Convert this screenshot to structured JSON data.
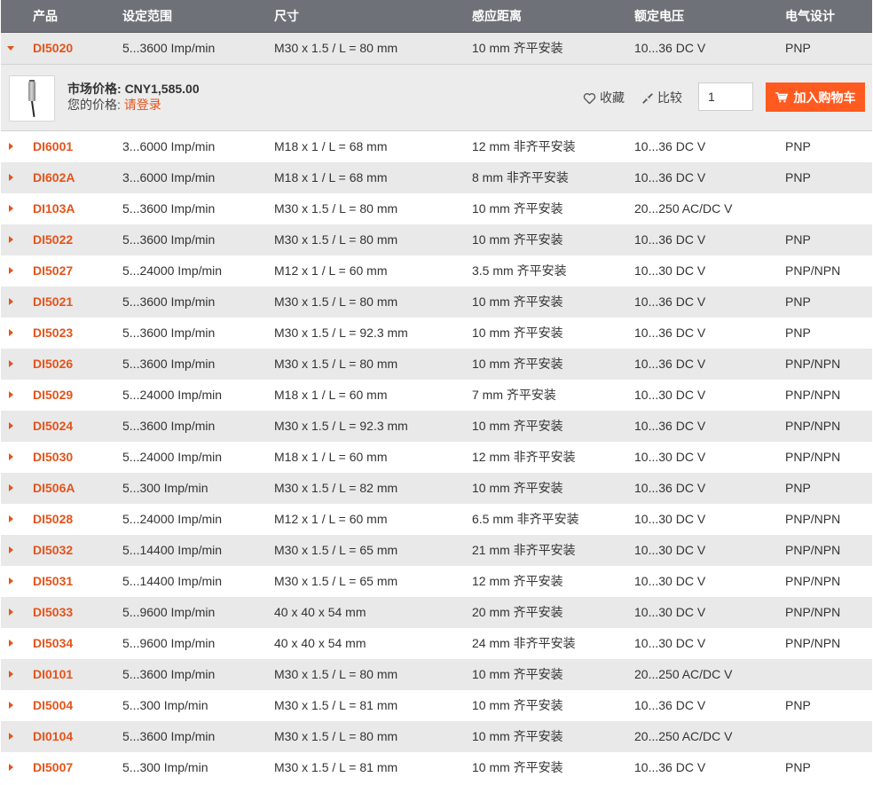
{
  "header": {
    "product": "产品",
    "range": "设定范围",
    "size": "尺寸",
    "distance": "感应距离",
    "voltage": "额定电压",
    "electrical": "电气设计"
  },
  "expanded": {
    "product": "DI5020",
    "range": "5...3600 Imp/min",
    "size": "M30 x 1.5 / L = 80 mm",
    "distance": "10 mm 齐平安装",
    "voltage": "10...36 DC V",
    "electrical": "PNP",
    "market_price_label": "市场价格:",
    "market_price": "CNY1,585.00",
    "your_price_label": "您的价格:",
    "login_link": "请登录",
    "favorite_label": "收藏",
    "compare_label": "比较",
    "quantity": "1",
    "add_to_cart_label": "加入购物车",
    "icons": [
      "caret-down-icon",
      "heart-icon",
      "compare-icon",
      "cart-icon"
    ]
  },
  "rows": [
    {
      "product": "DI6001",
      "range": "3...6000 Imp/min",
      "size": "M18 x 1 / L = 68 mm",
      "distance": "12 mm 非齐平安装",
      "voltage": "10...36 DC V",
      "electrical": "PNP"
    },
    {
      "product": "DI602A",
      "range": "3...6000 Imp/min",
      "size": "M18 x 1 / L = 68 mm",
      "distance": "8 mm 非齐平安装",
      "voltage": "10...36 DC V",
      "electrical": "PNP"
    },
    {
      "product": "DI103A",
      "range": "5...3600 Imp/min",
      "size": "M30 x 1.5 / L = 80 mm",
      "distance": "10 mm 齐平安装",
      "voltage": "20...250 AC/DC V",
      "electrical": ""
    },
    {
      "product": "DI5022",
      "range": "5...3600 Imp/min",
      "size": "M30 x 1.5 / L = 80 mm",
      "distance": "10 mm 齐平安装",
      "voltage": "10...36 DC V",
      "electrical": "PNP"
    },
    {
      "product": "DI5027",
      "range": "5...24000 Imp/min",
      "size": "M12 x 1 / L = 60 mm",
      "distance": "3.5 mm 齐平安装",
      "voltage": "10...30 DC V",
      "electrical": "PNP/NPN"
    },
    {
      "product": "DI5021",
      "range": "5...3600 Imp/min",
      "size": "M30 x 1.5 / L = 80 mm",
      "distance": "10 mm 齐平安装",
      "voltage": "10...36 DC V",
      "electrical": "PNP"
    },
    {
      "product": "DI5023",
      "range": "5...3600 Imp/min",
      "size": "M30 x 1.5 / L = 92.3 mm",
      "distance": "10 mm 齐平安装",
      "voltage": "10...36 DC V",
      "electrical": "PNP"
    },
    {
      "product": "DI5026",
      "range": "5...3600 Imp/min",
      "size": "M30 x 1.5 / L = 80 mm",
      "distance": "10 mm 齐平安装",
      "voltage": "10...36 DC V",
      "electrical": "PNP/NPN"
    },
    {
      "product": "DI5029",
      "range": "5...24000 Imp/min",
      "size": "M18 x 1 / L = 60 mm",
      "distance": "7 mm 齐平安装",
      "voltage": "10...30 DC V",
      "electrical": "PNP/NPN"
    },
    {
      "product": "DI5024",
      "range": "5...3600 Imp/min",
      "size": "M30 x 1.5 / L = 92.3 mm",
      "distance": "10 mm 齐平安装",
      "voltage": "10...36 DC V",
      "electrical": "PNP/NPN"
    },
    {
      "product": "DI5030",
      "range": "5...24000 Imp/min",
      "size": "M18 x 1 / L = 60 mm",
      "distance": "12 mm 非齐平安装",
      "voltage": "10...30 DC V",
      "electrical": "PNP/NPN"
    },
    {
      "product": "DI506A",
      "range": "5...300 Imp/min",
      "size": "M30 x 1.5 / L = 82 mm",
      "distance": "10 mm 齐平安装",
      "voltage": "10...36 DC V",
      "electrical": "PNP"
    },
    {
      "product": "DI5028",
      "range": "5...24000 Imp/min",
      "size": "M12 x 1 / L = 60 mm",
      "distance": "6.5 mm 非齐平安装",
      "voltage": "10...30 DC V",
      "electrical": "PNP/NPN"
    },
    {
      "product": "DI5032",
      "range": "5...14400 Imp/min",
      "size": "M30 x 1.5 / L = 65 mm",
      "distance": "21 mm 非齐平安装",
      "voltage": "10...30 DC V",
      "electrical": "PNP/NPN"
    },
    {
      "product": "DI5031",
      "range": "5...14400 Imp/min",
      "size": "M30 x 1.5 / L = 65 mm",
      "distance": "12 mm 齐平安装",
      "voltage": "10...30 DC V",
      "electrical": "PNP/NPN"
    },
    {
      "product": "DI5033",
      "range": "5...9600 Imp/min",
      "size": "40 x 40 x 54 mm",
      "distance": "20 mm 齐平安装",
      "voltage": "10...30 DC V",
      "electrical": "PNP/NPN"
    },
    {
      "product": "DI5034",
      "range": "5...9600 Imp/min",
      "size": "40 x 40 x 54 mm",
      "distance": "24 mm 非齐平安装",
      "voltage": "10...30 DC V",
      "electrical": "PNP/NPN"
    },
    {
      "product": "DI0101",
      "range": "5...3600 Imp/min",
      "size": "M30 x 1.5 / L = 80 mm",
      "distance": "10 mm 齐平安装",
      "voltage": "20...250 AC/DC V",
      "electrical": ""
    },
    {
      "product": "DI5004",
      "range": "5...300 Imp/min",
      "size": "M30 x 1.5 / L = 81 mm",
      "distance": "10 mm 齐平安装",
      "voltage": "10...36 DC V",
      "electrical": "PNP"
    },
    {
      "product": "DI0104",
      "range": "5...3600 Imp/min",
      "size": "M30 x 1.5 / L = 80 mm",
      "distance": "10 mm 齐平安装",
      "voltage": "20...250 AC/DC V",
      "electrical": ""
    },
    {
      "product": "DI5007",
      "range": "5...300 Imp/min",
      "size": "M30 x 1.5 / L = 81 mm",
      "distance": "10 mm 齐平安装",
      "voltage": "10...36 DC V",
      "electrical": "PNP"
    }
  ],
  "colors": {
    "header_bg": "#6e7177",
    "accent": "#e5531a",
    "button": "#ff5a1f",
    "row_alt": "#e9e9e9"
  }
}
